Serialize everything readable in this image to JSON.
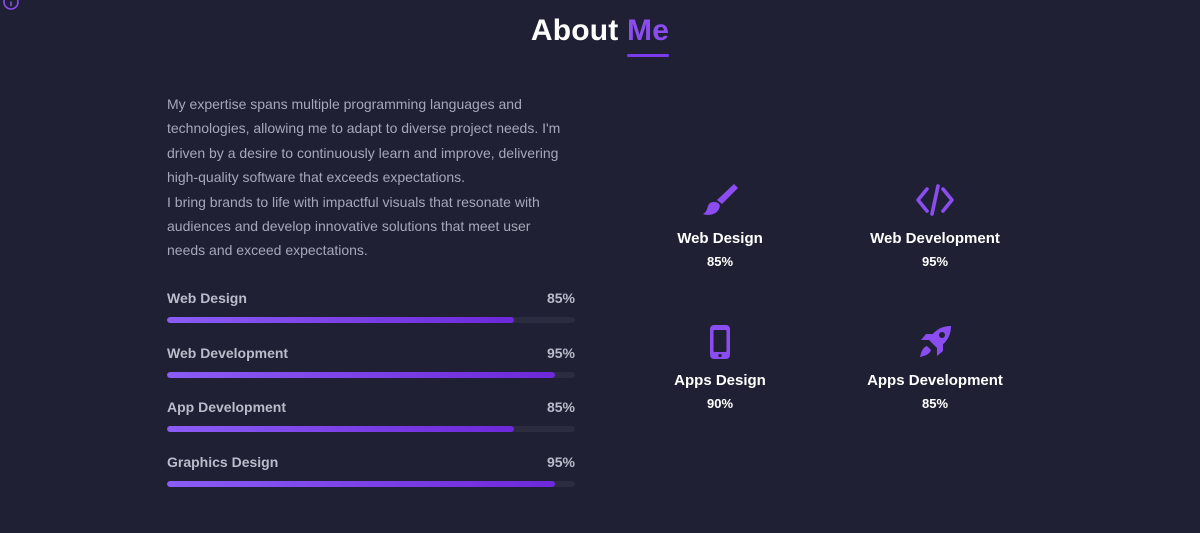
{
  "colors": {
    "background": "#1f2033",
    "accent": "#8b4cf0",
    "bar_track": "#2b2c40",
    "text_muted": "#a6a8b9"
  },
  "header": {
    "title_main": "About",
    "title_accent": "Me",
    "corner_icon": "circle-icon"
  },
  "bio": {
    "paragraphs": [
      "My expertise spans multiple programming languages and technologies, allowing me to adapt to diverse project needs. I'm driven by a desire to continuously learn and improve, delivering high-quality software that exceeds expectations.",
      "I bring brands to life with impactful visuals that resonate with audiences and develop innovative solutions that meet user needs and exceed expectations."
    ]
  },
  "skills": [
    {
      "label": "Web Design",
      "percent_label": "85%",
      "level": 85
    },
    {
      "label": "Web Development",
      "percent_label": "95%",
      "level": 95
    },
    {
      "label": "App Development",
      "percent_label": "85%",
      "level": 85
    },
    {
      "label": "Graphics Design",
      "percent_label": "95%",
      "level": 95
    }
  ],
  "services": [
    {
      "name": "Web Design",
      "percent": "85%",
      "icon": "paintbrush-icon"
    },
    {
      "name": "Web Development",
      "percent": "95%",
      "icon": "code-icon"
    },
    {
      "name": "Apps Design",
      "percent": "90%",
      "icon": "mobile-icon"
    },
    {
      "name": "Apps Development",
      "percent": "85%",
      "icon": "rocket-icon"
    }
  ]
}
